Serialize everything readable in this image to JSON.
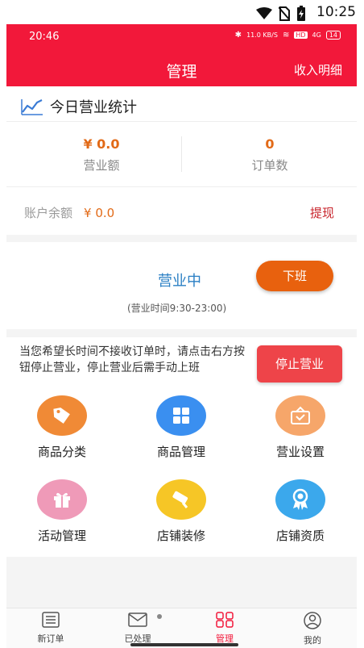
{
  "system_status": {
    "time": "10:25",
    "icons": [
      "wifi-icon",
      "no-sim-icon",
      "battery-charging-icon"
    ]
  },
  "inner_status": {
    "time": "20:46",
    "speed": "11.0 KB/S",
    "hd": "HD",
    "signal": "4G",
    "battery": "14"
  },
  "header": {
    "title": "管理",
    "right_link": "收入明细"
  },
  "stats": {
    "title": "今日营业统计",
    "title_icon": "line-chart-icon",
    "revenue_value": "¥ 0.0",
    "revenue_label": "营业额",
    "orders_value": "0",
    "orders_label": "订单数",
    "balance_label": "账户余额",
    "balance_value": "¥ 0.0",
    "withdraw_label": "提现"
  },
  "business": {
    "status": "营业中",
    "off_button": "下班",
    "hours": "(营业时间9:30-23:00)"
  },
  "notice": {
    "text": "当您希望长时间不接收订单时，请点击右方按钮停止营业，停止营业后需手动上班",
    "stop_button": "停止营业"
  },
  "menu": {
    "items": [
      {
        "label": "商品分类",
        "icon": "tag-icon",
        "color": "#f08a36"
      },
      {
        "label": "商品管理",
        "icon": "grid-icon",
        "color": "#3a8ff0"
      },
      {
        "label": "营业设置",
        "icon": "shop-bag-icon",
        "color": "#f6a66a"
      },
      {
        "label": "活动管理",
        "icon": "gift-icon",
        "color": "#ef9ab8"
      },
      {
        "label": "店铺装修",
        "icon": "paint-roller-icon",
        "color": "#f6c626"
      },
      {
        "label": "店铺资质",
        "icon": "award-badge-icon",
        "color": "#3ba8ec"
      }
    ]
  },
  "tabbar": {
    "tabs": [
      {
        "label": "新订单",
        "icon": "list-icon"
      },
      {
        "label": "已处理",
        "icon": "mail-icon"
      },
      {
        "label": "管理",
        "icon": "manage-grid-icon",
        "active": true
      },
      {
        "label": "我的",
        "icon": "user-icon"
      }
    ]
  },
  "colors": {
    "accent": "#f2183a",
    "orange": "#e8610e",
    "stop_red": "#ee4449",
    "status_blue": "#2a7fc4"
  }
}
